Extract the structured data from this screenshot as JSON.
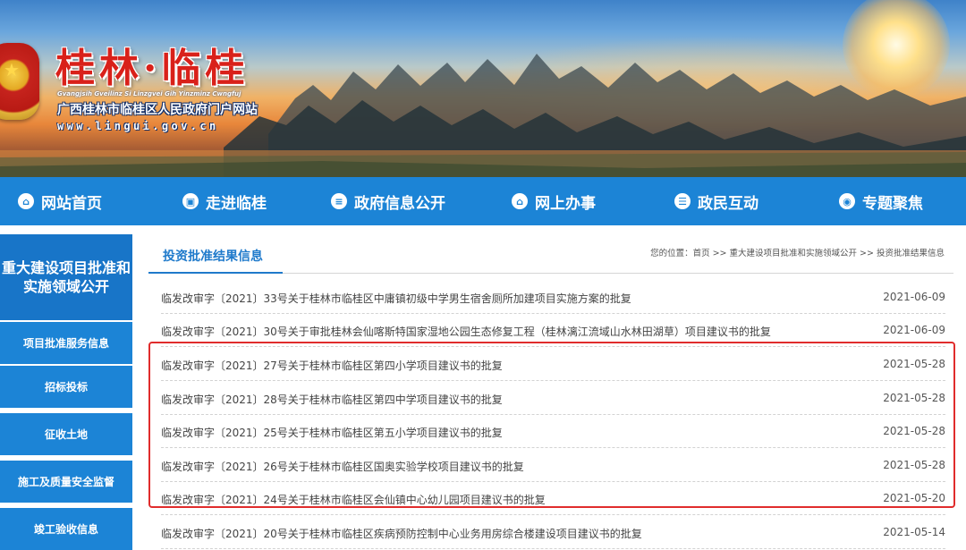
{
  "header": {
    "title": "桂林·临桂",
    "zhuang_subtitle": "Gvangjsih Gveilinz Si Linzgvei Gih Yinzminz Cwngfuj",
    "subtitle": "广西桂林市临桂区人民政府门户网站",
    "url": "www.lingui.gov.cn"
  },
  "nav": {
    "items": [
      {
        "label": "网站首页",
        "icon": "home-icon"
      },
      {
        "label": "走进临桂",
        "icon": "image-icon"
      },
      {
        "label": "政府信息公开",
        "icon": "document-icon"
      },
      {
        "label": "网上办事",
        "icon": "home-icon"
      },
      {
        "label": "政民互动",
        "icon": "chat-icon"
      },
      {
        "label": "专题聚焦",
        "icon": "focus-icon"
      }
    ]
  },
  "sidebar": {
    "heading": "重大建设项目批准和实施领域公开",
    "items": [
      {
        "label": "项目批准服务信息"
      },
      {
        "label": "招标投标"
      },
      {
        "label": "征收土地"
      },
      {
        "label": "施工及质量安全监督"
      },
      {
        "label": "竣工验收信息"
      }
    ]
  },
  "main": {
    "title": "投资批准结果信息",
    "breadcrumb": "您的位置：首页 >> 重大建设项目批准和实施领域公开 >> 投资批准结果信息",
    "rows": [
      {
        "title": "临发改审字〔2021〕33号关于桂林市临桂区中庸镇初级中学男生宿舍厕所加建项目实施方案的批复",
        "date": "2021-06-09"
      },
      {
        "title": "临发改审字〔2021〕30号关于审批桂林会仙喀斯特国家湿地公园生态修复工程（桂林漓江流域山水林田湖草）项目建议书的批复",
        "date": "2021-06-09"
      },
      {
        "title": "临发改审字〔2021〕27号关于桂林市临桂区第四小学项目建议书的批复",
        "date": "2021-05-28"
      },
      {
        "title": "临发改审字〔2021〕28号关于桂林市临桂区第四中学项目建议书的批复",
        "date": "2021-05-28"
      },
      {
        "title": "临发改审字〔2021〕25号关于桂林市临桂区第五小学项目建议书的批复",
        "date": "2021-05-28"
      },
      {
        "title": "临发改审字〔2021〕26号关于桂林市临桂区国奥实验学校项目建议书的批复",
        "date": "2021-05-28"
      },
      {
        "title": "临发改审字〔2021〕24号关于桂林市临桂区会仙镇中心幼儿园项目建议书的批复",
        "date": "2021-05-20"
      },
      {
        "title": "临发改审字〔2021〕20号关于桂林市临桂区疾病预防控制中心业务用房综合楼建设项目建议书的批复",
        "date": "2021-05-14"
      }
    ]
  },
  "colors": {
    "nav_blue": "#1c84d6",
    "sidebar_head_blue": "#1875c8",
    "title_blue": "#1f7acb",
    "highlight_red": "#e02c2c"
  }
}
